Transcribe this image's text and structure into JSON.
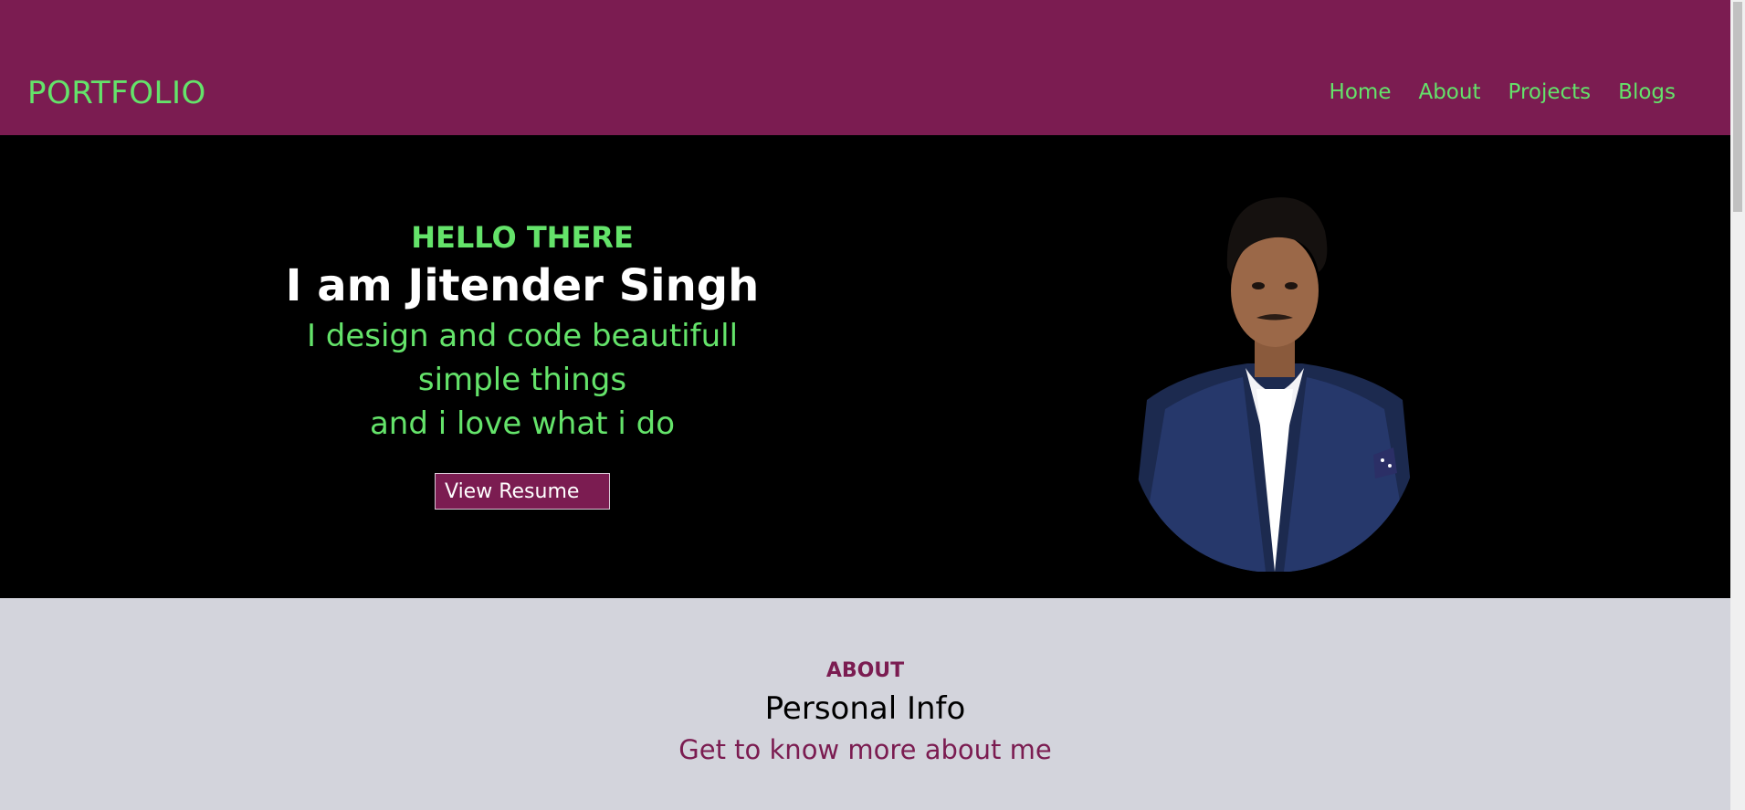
{
  "header": {
    "logo": "PORTFOLIO",
    "nav": [
      "Home",
      "About",
      "Projects",
      "Blogs"
    ]
  },
  "hero": {
    "greeting": "HELLO THERE",
    "name": "I am Jitender Singh",
    "tagline_lines": [
      "I design and code beautifull",
      "simple things",
      "and i love what i do"
    ],
    "resume_button": "View Resume"
  },
  "about": {
    "kicker": "ABOUT",
    "title": "Personal Info",
    "subtitle": "Get to know more about me"
  },
  "colors": {
    "header_bg": "#7b1c51",
    "accent_green": "#64e36a",
    "hero_bg": "#000000",
    "about_bg": "#d3d4dc"
  }
}
